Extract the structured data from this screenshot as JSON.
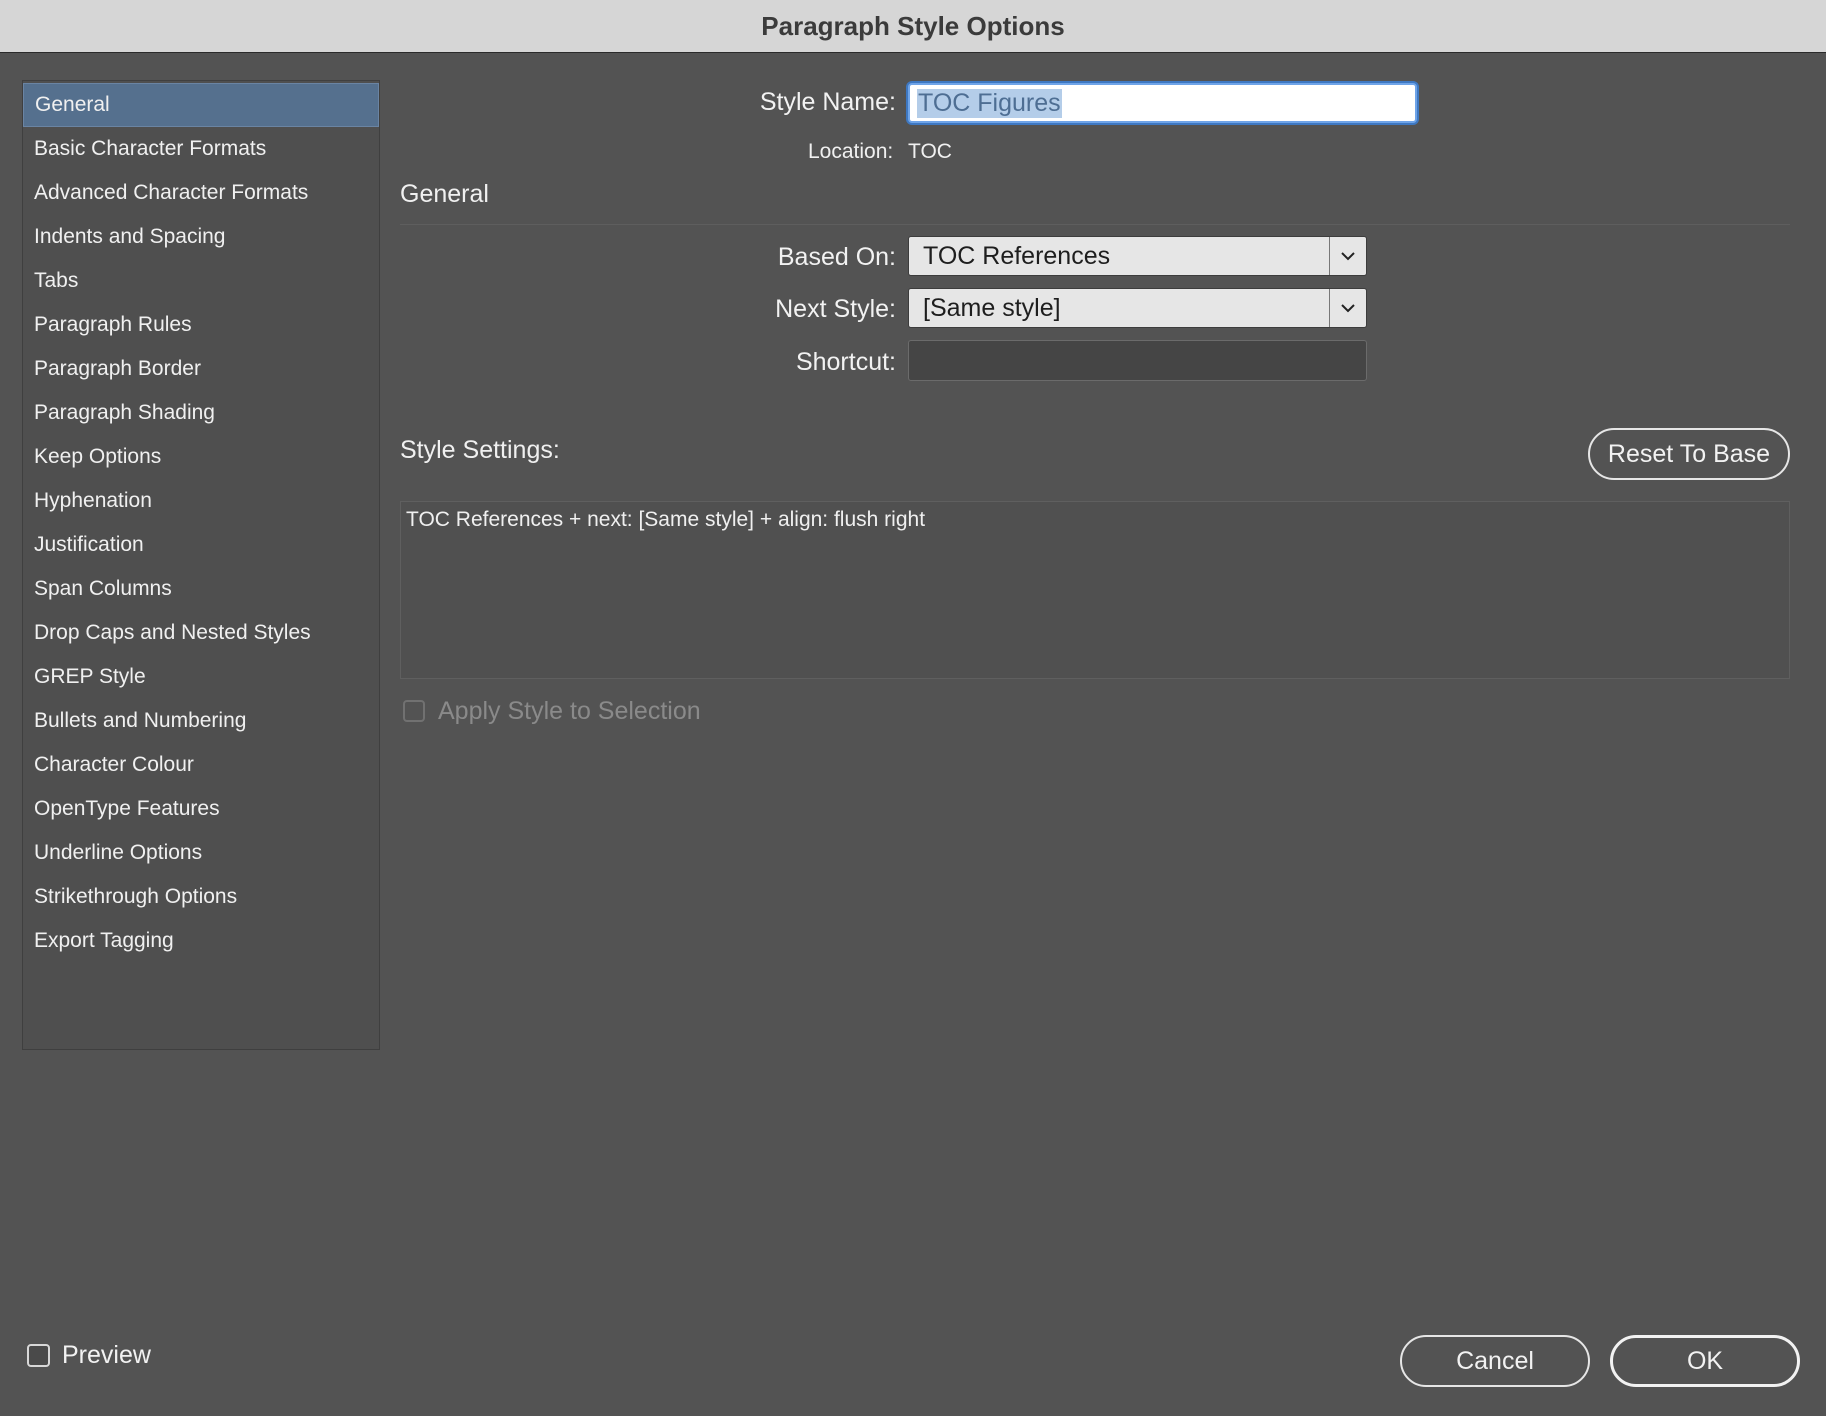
{
  "window": {
    "title": "Paragraph Style Options"
  },
  "sidebar": {
    "items": [
      {
        "label": "General",
        "selected": true
      },
      {
        "label": "Basic Character Formats"
      },
      {
        "label": "Advanced Character Formats"
      },
      {
        "label": "Indents and Spacing"
      },
      {
        "label": "Tabs"
      },
      {
        "label": "Paragraph Rules"
      },
      {
        "label": "Paragraph Border"
      },
      {
        "label": "Paragraph Shading"
      },
      {
        "label": "Keep Options"
      },
      {
        "label": "Hyphenation"
      },
      {
        "label": "Justification"
      },
      {
        "label": "Span Columns"
      },
      {
        "label": "Drop Caps and Nested Styles"
      },
      {
        "label": "GREP Style"
      },
      {
        "label": "Bullets and Numbering"
      },
      {
        "label": "Character Colour"
      },
      {
        "label": "OpenType Features"
      },
      {
        "label": "Underline Options"
      },
      {
        "label": "Strikethrough Options"
      },
      {
        "label": "Export Tagging"
      }
    ]
  },
  "form": {
    "style_name_label": "Style Name:",
    "style_name_value": "TOC Figures",
    "location_label": "Location:",
    "location_value": "TOC",
    "section_title": "General",
    "based_on_label": "Based On:",
    "based_on_value": "TOC References",
    "next_style_label": "Next Style:",
    "next_style_value": "[Same style]",
    "shortcut_label": "Shortcut:",
    "shortcut_value": "",
    "style_settings_label": "Style Settings:",
    "reset_button": "Reset To Base",
    "style_settings_text": "TOC References + next: [Same style] + align: flush right",
    "apply_style_label": "Apply Style to Selection",
    "apply_style_checked": false
  },
  "footer": {
    "preview_label": "Preview",
    "preview_checked": false,
    "cancel_button": "Cancel",
    "ok_button": "OK"
  },
  "colors": {
    "dialog_bg": "#535353",
    "titlebar_bg": "#d6d6d6",
    "selected_item_bg": "#55708e",
    "focus_ring": "#3e78c2"
  },
  "icons": {
    "dropdown": "chevron-down-icon"
  }
}
